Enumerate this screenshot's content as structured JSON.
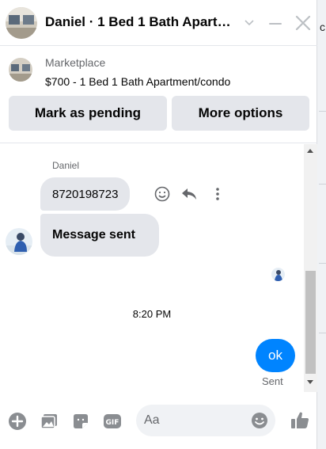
{
  "header": {
    "title": "Daniel · 1 Bed 1 Bath Apart…"
  },
  "listing": {
    "source": "Marketplace",
    "summary": "$700 - 1 Bed 1 Bath Apartment/condo",
    "buttons": {
      "pending": "Mark as pending",
      "options": "More options"
    }
  },
  "conversation": {
    "sender_name": "Daniel",
    "incoming": [
      {
        "text": "8720198723"
      },
      {
        "text": "Message sent"
      }
    ],
    "timestamp": "8:20 PM",
    "outgoing": {
      "text": "ok",
      "status": "Sent"
    }
  },
  "composer": {
    "placeholder": "Aa"
  },
  "colors": {
    "accent": "#0084ff",
    "bubble_in": "#e4e6eb",
    "icon": "#8a8d91"
  }
}
